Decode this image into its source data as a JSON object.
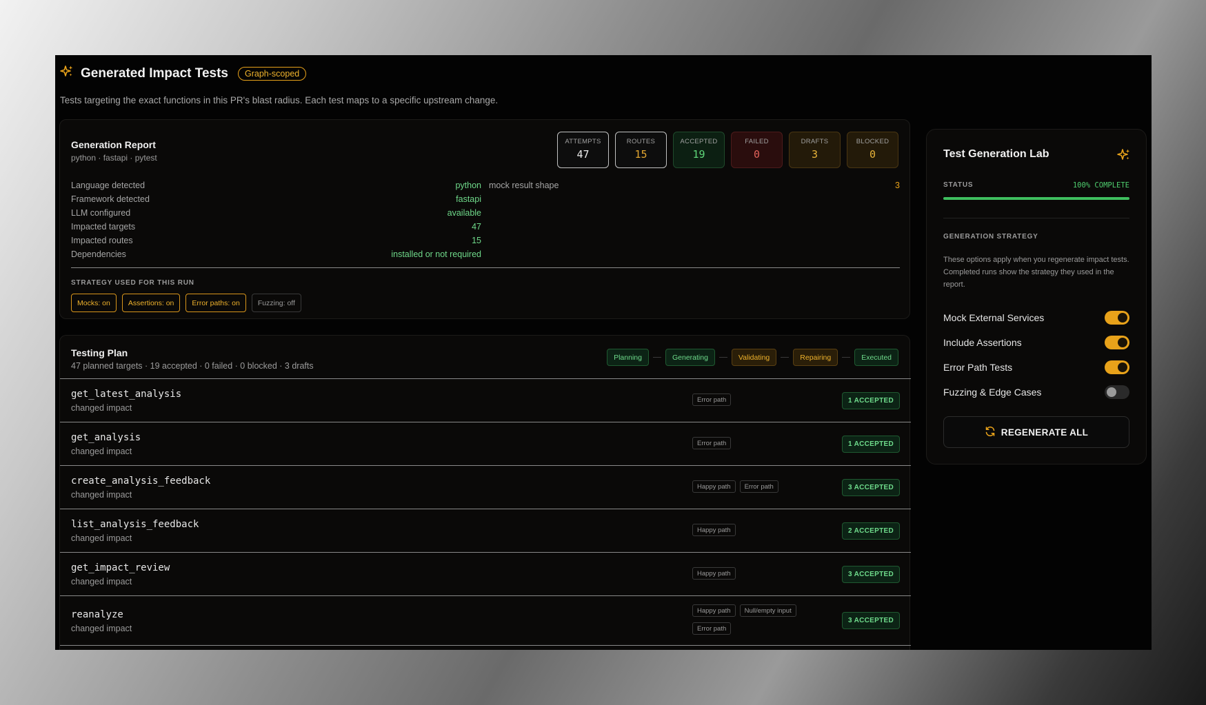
{
  "header": {
    "title": "Generated Impact Tests",
    "badge": "Graph-scoped",
    "subtitle": "Tests targeting the exact functions in this PR's blast radius. Each test maps to a specific upstream change."
  },
  "report": {
    "title": "Generation Report",
    "subtitle": "python · fastapi · pytest",
    "stats": [
      {
        "label": "ATTEMPTS",
        "value": "47"
      },
      {
        "label": "ROUTES",
        "value": "15"
      },
      {
        "label": "ACCEPTED",
        "value": "19"
      },
      {
        "label": "FAILED",
        "value": "0"
      },
      {
        "label": "DRAFTS",
        "value": "3"
      },
      {
        "label": "BLOCKED",
        "value": "0"
      }
    ],
    "details": [
      {
        "key": "Language detected",
        "value": "python"
      },
      {
        "key": "Framework detected",
        "value": "fastapi"
      },
      {
        "key": "LLM configured",
        "value": "available"
      },
      {
        "key": "Impacted targets",
        "value": "47"
      },
      {
        "key": "Impacted routes",
        "value": "15"
      },
      {
        "key": "Dependencies",
        "value": "installed or not required"
      }
    ],
    "mock": {
      "key": "mock result shape",
      "value": "3"
    },
    "strategy_label": "STRATEGY USED FOR THIS RUN",
    "strategy_chips": [
      "Mocks: on",
      "Assertions: on",
      "Error paths: on",
      "Fuzzing: off"
    ]
  },
  "plan": {
    "title": "Testing Plan",
    "subtitle": "47 planned targets · 19 accepted · 0 failed · 0 blocked · 3 drafts",
    "phases": [
      "Planning",
      "Generating",
      "Validating",
      "Repairing",
      "Executed"
    ],
    "rows": [
      {
        "name": "get_latest_analysis",
        "sub": "changed impact",
        "tags": [
          "Error path"
        ],
        "status": "1 ACCEPTED"
      },
      {
        "name": "get_analysis",
        "sub": "changed impact",
        "tags": [
          "Error path"
        ],
        "status": "1 ACCEPTED"
      },
      {
        "name": "create_analysis_feedback",
        "sub": "changed impact",
        "tags": [
          "Happy path",
          "Error path"
        ],
        "status": "3 ACCEPTED"
      },
      {
        "name": "list_analysis_feedback",
        "sub": "changed impact",
        "tags": [
          "Happy path"
        ],
        "status": "2 ACCEPTED"
      },
      {
        "name": "get_impact_review",
        "sub": "changed impact",
        "tags": [
          "Happy path"
        ],
        "status": "3 ACCEPTED"
      },
      {
        "name": "reanalyze",
        "sub": "changed impact",
        "tags": [
          "Happy path",
          "Null/empty input",
          "Error path"
        ],
        "status": "3 ACCEPTED"
      }
    ]
  },
  "lab": {
    "title": "Test Generation Lab",
    "status_label": "STATUS",
    "status_value": "100% COMPLETE",
    "progress": 1.0,
    "strategy_label": "GENERATION STRATEGY",
    "strategy_desc": "These options apply when you regenerate impact tests. Completed runs show the strategy they used in the report.",
    "toggles": [
      {
        "label": "Mock External Services",
        "on": true
      },
      {
        "label": "Include Assertions",
        "on": true
      },
      {
        "label": "Error Path Tests",
        "on": true
      },
      {
        "label": "Fuzzing & Edge Cases",
        "on": false
      }
    ],
    "regen_label": "REGENERATE ALL"
  },
  "colors": {
    "accent": "#e8a21a",
    "success": "#6fdc8c",
    "danger": "#e2625a"
  },
  "icons": {
    "header": "sparkle-icon",
    "lab": "sparkle-icon",
    "regen": "refresh-icon"
  }
}
